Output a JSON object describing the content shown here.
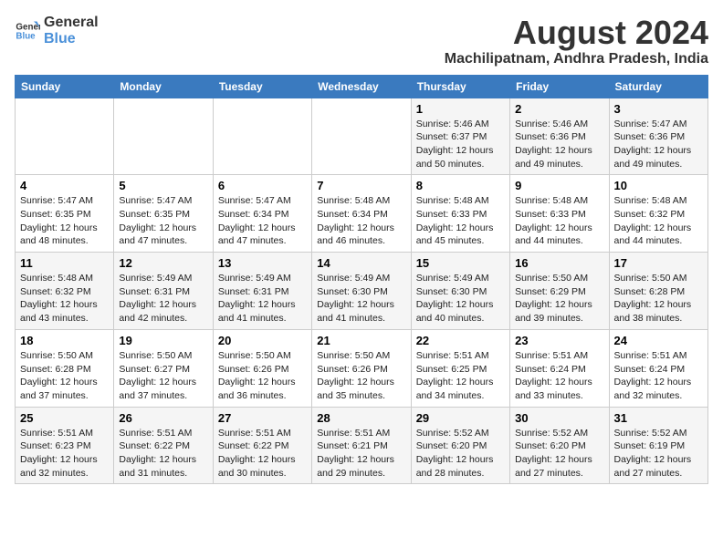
{
  "logo": {
    "line1": "General",
    "line2": "Blue"
  },
  "title": "August 2024",
  "location": "Machilipatnam, Andhra Pradesh, India",
  "days_of_week": [
    "Sunday",
    "Monday",
    "Tuesday",
    "Wednesday",
    "Thursday",
    "Friday",
    "Saturday"
  ],
  "weeks": [
    [
      {
        "day": "",
        "content": ""
      },
      {
        "day": "",
        "content": ""
      },
      {
        "day": "",
        "content": ""
      },
      {
        "day": "",
        "content": ""
      },
      {
        "day": "1",
        "content": "Sunrise: 5:46 AM\nSunset: 6:37 PM\nDaylight: 12 hours\nand 50 minutes."
      },
      {
        "day": "2",
        "content": "Sunrise: 5:46 AM\nSunset: 6:36 PM\nDaylight: 12 hours\nand 49 minutes."
      },
      {
        "day": "3",
        "content": "Sunrise: 5:47 AM\nSunset: 6:36 PM\nDaylight: 12 hours\nand 49 minutes."
      }
    ],
    [
      {
        "day": "4",
        "content": "Sunrise: 5:47 AM\nSunset: 6:35 PM\nDaylight: 12 hours\nand 48 minutes."
      },
      {
        "day": "5",
        "content": "Sunrise: 5:47 AM\nSunset: 6:35 PM\nDaylight: 12 hours\nand 47 minutes."
      },
      {
        "day": "6",
        "content": "Sunrise: 5:47 AM\nSunset: 6:34 PM\nDaylight: 12 hours\nand 47 minutes."
      },
      {
        "day": "7",
        "content": "Sunrise: 5:48 AM\nSunset: 6:34 PM\nDaylight: 12 hours\nand 46 minutes."
      },
      {
        "day": "8",
        "content": "Sunrise: 5:48 AM\nSunset: 6:33 PM\nDaylight: 12 hours\nand 45 minutes."
      },
      {
        "day": "9",
        "content": "Sunrise: 5:48 AM\nSunset: 6:33 PM\nDaylight: 12 hours\nand 44 minutes."
      },
      {
        "day": "10",
        "content": "Sunrise: 5:48 AM\nSunset: 6:32 PM\nDaylight: 12 hours\nand 44 minutes."
      }
    ],
    [
      {
        "day": "11",
        "content": "Sunrise: 5:48 AM\nSunset: 6:32 PM\nDaylight: 12 hours\nand 43 minutes."
      },
      {
        "day": "12",
        "content": "Sunrise: 5:49 AM\nSunset: 6:31 PM\nDaylight: 12 hours\nand 42 minutes."
      },
      {
        "day": "13",
        "content": "Sunrise: 5:49 AM\nSunset: 6:31 PM\nDaylight: 12 hours\nand 41 minutes."
      },
      {
        "day": "14",
        "content": "Sunrise: 5:49 AM\nSunset: 6:30 PM\nDaylight: 12 hours\nand 41 minutes."
      },
      {
        "day": "15",
        "content": "Sunrise: 5:49 AM\nSunset: 6:30 PM\nDaylight: 12 hours\nand 40 minutes."
      },
      {
        "day": "16",
        "content": "Sunrise: 5:50 AM\nSunset: 6:29 PM\nDaylight: 12 hours\nand 39 minutes."
      },
      {
        "day": "17",
        "content": "Sunrise: 5:50 AM\nSunset: 6:28 PM\nDaylight: 12 hours\nand 38 minutes."
      }
    ],
    [
      {
        "day": "18",
        "content": "Sunrise: 5:50 AM\nSunset: 6:28 PM\nDaylight: 12 hours\nand 37 minutes."
      },
      {
        "day": "19",
        "content": "Sunrise: 5:50 AM\nSunset: 6:27 PM\nDaylight: 12 hours\nand 37 minutes."
      },
      {
        "day": "20",
        "content": "Sunrise: 5:50 AM\nSunset: 6:26 PM\nDaylight: 12 hours\nand 36 minutes."
      },
      {
        "day": "21",
        "content": "Sunrise: 5:50 AM\nSunset: 6:26 PM\nDaylight: 12 hours\nand 35 minutes."
      },
      {
        "day": "22",
        "content": "Sunrise: 5:51 AM\nSunset: 6:25 PM\nDaylight: 12 hours\nand 34 minutes."
      },
      {
        "day": "23",
        "content": "Sunrise: 5:51 AM\nSunset: 6:24 PM\nDaylight: 12 hours\nand 33 minutes."
      },
      {
        "day": "24",
        "content": "Sunrise: 5:51 AM\nSunset: 6:24 PM\nDaylight: 12 hours\nand 32 minutes."
      }
    ],
    [
      {
        "day": "25",
        "content": "Sunrise: 5:51 AM\nSunset: 6:23 PM\nDaylight: 12 hours\nand 32 minutes."
      },
      {
        "day": "26",
        "content": "Sunrise: 5:51 AM\nSunset: 6:22 PM\nDaylight: 12 hours\nand 31 minutes."
      },
      {
        "day": "27",
        "content": "Sunrise: 5:51 AM\nSunset: 6:22 PM\nDaylight: 12 hours\nand 30 minutes."
      },
      {
        "day": "28",
        "content": "Sunrise: 5:51 AM\nSunset: 6:21 PM\nDaylight: 12 hours\nand 29 minutes."
      },
      {
        "day": "29",
        "content": "Sunrise: 5:52 AM\nSunset: 6:20 PM\nDaylight: 12 hours\nand 28 minutes."
      },
      {
        "day": "30",
        "content": "Sunrise: 5:52 AM\nSunset: 6:20 PM\nDaylight: 12 hours\nand 27 minutes."
      },
      {
        "day": "31",
        "content": "Sunrise: 5:52 AM\nSunset: 6:19 PM\nDaylight: 12 hours\nand 27 minutes."
      }
    ]
  ]
}
